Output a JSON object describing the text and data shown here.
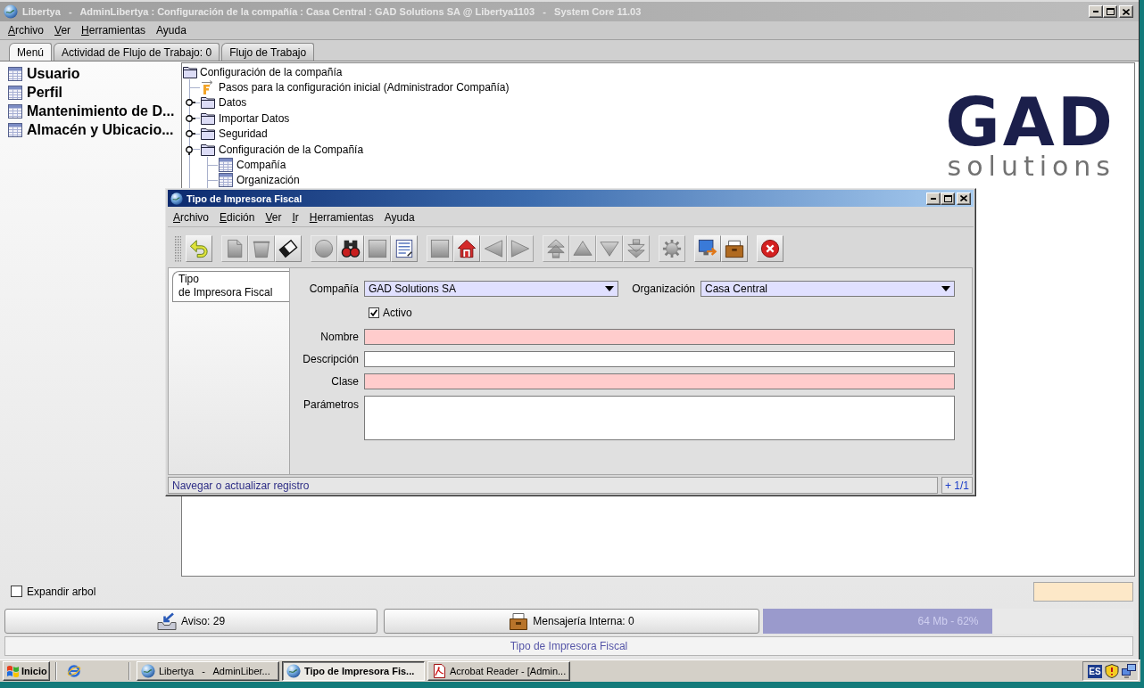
{
  "window": {
    "title": "Libertya   -   AdminLibertya : Configuración de la compañía : Casa Central : GAD Solutions SA @ Libertya1103   -   System Core 11.03"
  },
  "menu": [
    {
      "label": "Archivo",
      "mnemonic": true
    },
    {
      "label": "Ver",
      "mnemonic": true
    },
    {
      "label": "Herramientas",
      "mnemonic": true
    },
    {
      "label": "Ayuda",
      "mnemonic": false
    }
  ],
  "tabs": [
    {
      "label": "Menú",
      "selected": true
    },
    {
      "label": "Actividad de Flujo de Trabajo: 0",
      "selected": false
    },
    {
      "label": "Flujo de Trabajo",
      "selected": false
    }
  ],
  "favorites": [
    "Usuario",
    "Perfil",
    "Mantenimiento de D...",
    "Almacén y Ubicacio..."
  ],
  "tree": {
    "label": "Configuración de la compañía",
    "kind": "folder",
    "children": [
      {
        "label": "Pasos para la configuración inicial (Administrador Compañía)",
        "kind": "workflow"
      },
      {
        "label": "Datos",
        "kind": "folder",
        "expanded": false
      },
      {
        "label": "Importar Datos",
        "kind": "folder",
        "expanded": false
      },
      {
        "label": "Seguridad",
        "kind": "folder",
        "expanded": false
      },
      {
        "label": "Configuración de la Compañía",
        "kind": "folder",
        "expanded": true,
        "children": [
          {
            "label": "Compañía",
            "kind": "window"
          },
          {
            "label": "Organización",
            "kind": "window"
          }
        ]
      }
    ]
  },
  "logo": {
    "mark": "GAD",
    "tagline": "solutions"
  },
  "expand_tree": {
    "label": "Expandir arbol",
    "checked": false
  },
  "status_buttons": [
    {
      "kind": "notices",
      "label": "Aviso: 29"
    },
    {
      "kind": "messages",
      "label": "Mensajería Interna: 0"
    }
  ],
  "memory": {
    "reading": "64 Mb - 62%",
    "level": 0.62
  },
  "status_bar": "Tipo de Impresora Fiscal",
  "dialog": {
    "title": "Tipo de Impresora Fiscal",
    "menu": [
      {
        "label": "Archivo",
        "mnemonic": true
      },
      {
        "label": "Edición",
        "mnemonic": true
      },
      {
        "label": "Ver",
        "mnemonic": true
      },
      {
        "label": "Ir",
        "mnemonic": true
      },
      {
        "label": "Herramientas",
        "mnemonic": true
      },
      {
        "label": "Ayuda",
        "mnemonic": false
      }
    ],
    "toolbar_groups": [
      [
        {
          "kind": "undo",
          "disabled": false
        }
      ],
      [
        {
          "kind": "new",
          "disabled": true
        },
        {
          "kind": "delete",
          "disabled": true
        },
        {
          "kind": "save",
          "disabled": false
        }
      ],
      [
        {
          "kind": "refresh",
          "disabled": true
        },
        {
          "kind": "find",
          "disabled": false
        },
        {
          "kind": "attachment",
          "disabled": true
        },
        {
          "kind": "grid",
          "disabled": false
        }
      ],
      [
        {
          "kind": "history",
          "disabled": true
        },
        {
          "kind": "home",
          "disabled": false
        },
        {
          "kind": "back",
          "disabled": true
        },
        {
          "kind": "forward",
          "disabled": true
        }
      ],
      [
        {
          "kind": "first",
          "disabled": true
        },
        {
          "kind": "previous",
          "disabled": true
        },
        {
          "kind": "next",
          "disabled": true
        },
        {
          "kind": "last",
          "disabled": true
        }
      ],
      [
        {
          "kind": "report",
          "disabled": true
        }
      ],
      [
        {
          "kind": "preview",
          "disabled": false
        },
        {
          "kind": "archive",
          "disabled": false
        }
      ],
      [
        {
          "kind": "exit",
          "disabled": false
        }
      ]
    ],
    "tabs": [
      {
        "label": "Tipo\nde Impresora Fiscal",
        "selected": true
      }
    ],
    "form": {
      "rows": [
        [
          {
            "kind": "combo",
            "label": "Compañía",
            "value": "GAD Solutions SA",
            "mandatory": true
          },
          {
            "kind": "combo",
            "label": "Organización",
            "value": "Casa Central",
            "mandatory": true
          }
        ],
        [
          {
            "kind": "checkbox",
            "label": "Activo",
            "checked": true
          }
        ],
        [
          {
            "kind": "text",
            "label": "Nombre",
            "mandatory": true
          }
        ],
        [
          {
            "kind": "text",
            "label": "Descripción",
            "mandatory": false
          }
        ],
        [
          {
            "kind": "text",
            "label": "Clase",
            "mandatory": true
          }
        ],
        [
          {
            "kind": "textarea",
            "label": "Parámetros",
            "mandatory": false
          }
        ]
      ]
    },
    "status": {
      "message": "Navegar o actualizar registro",
      "record": "+ 1/1"
    }
  },
  "taskbar": {
    "start": "Inicio",
    "tasks": [
      {
        "kind": "app",
        "label": "Libertya   -   AdminLiber...",
        "selected": false
      },
      {
        "kind": "app",
        "label": "Tipo de Impresora Fis...",
        "selected": true
      },
      {
        "kind": "pdf",
        "label": "Acrobat Reader - [Admin...",
        "selected": false
      }
    ],
    "language": "ES"
  }
}
